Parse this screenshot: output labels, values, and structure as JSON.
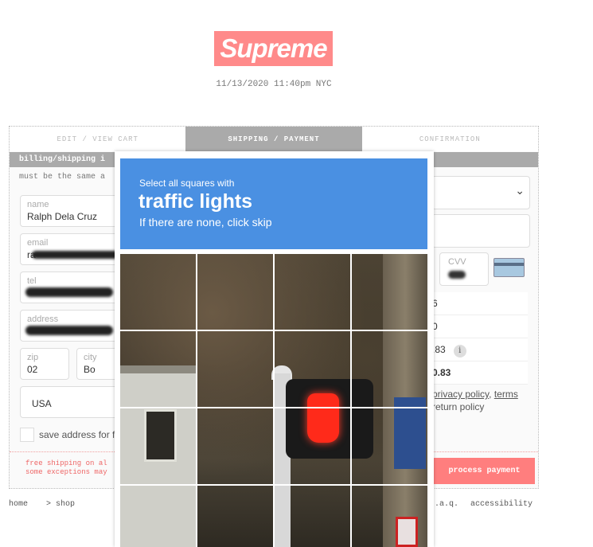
{
  "brand": {
    "logo_text": "Supreme",
    "color": "#ff8a8a"
  },
  "timestamp": "11/13/2020 11:40pm NYC",
  "tabs": [
    {
      "label": "EDIT / VIEW CART",
      "active": false
    },
    {
      "label": "SHIPPING / PAYMENT",
      "active": true
    },
    {
      "label": "CONFIRMATION",
      "active": false
    }
  ],
  "billing": {
    "section_title": "billing/shipping i",
    "note": "must be the same a",
    "name": {
      "label": "name",
      "value": "Ralph Dela Cruz"
    },
    "email": {
      "label": "email",
      "value": "ra"
    },
    "tel": {
      "label": "tel"
    },
    "address": {
      "label": "address"
    },
    "zip": {
      "label": "zip",
      "value": "02"
    },
    "city": {
      "label": "city",
      "value": "Bo"
    },
    "country": "USA",
    "save_address_label": "save address for f"
  },
  "payment": {
    "cvv_label": "CVV",
    "summary_rows": [
      "6",
      "0",
      ".83",
      "0.83"
    ],
    "info_icon": "i",
    "policy_lines": {
      "privacy": "privacy policy",
      "sep": ", ",
      "terms": "terms",
      "return": "return policy"
    },
    "process_button": "process payment"
  },
  "free_shipping_note": [
    "free shipping on al",
    "some exceptions may"
  ],
  "footer": {
    "home": "home",
    "shop": "> shop",
    "faq": ".a.q.",
    "accessibility": "accessibility"
  },
  "captcha": {
    "prompt_line1": "Select all squares with",
    "target": "traffic lights",
    "prompt_line3": "If there are none, click skip",
    "header_color": "#4a90e2",
    "grid_size": 4
  }
}
